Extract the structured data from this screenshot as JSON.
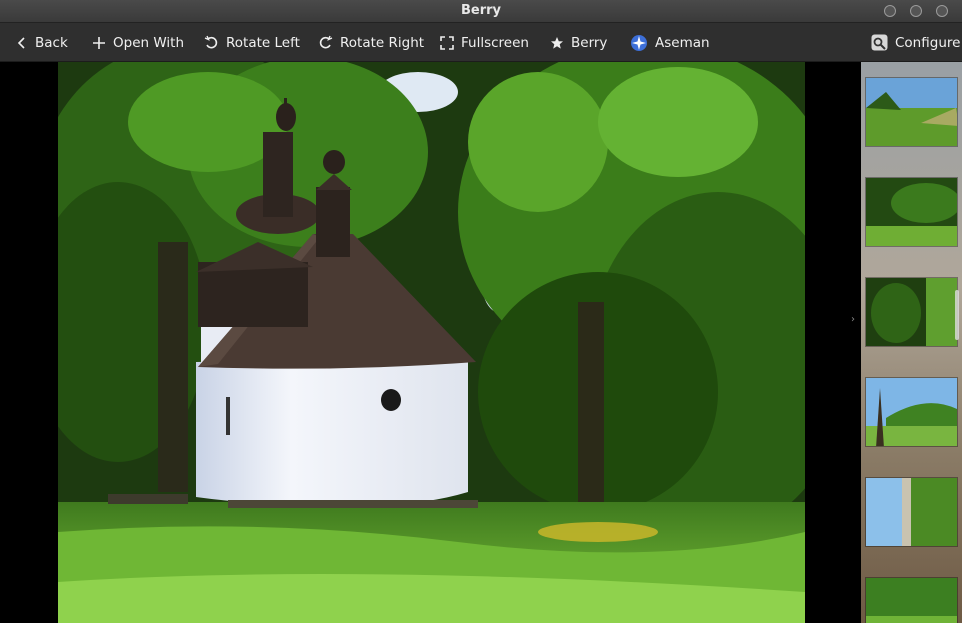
{
  "window": {
    "title": "Berry"
  },
  "toolbar": {
    "back": "Back",
    "open_with": "Open With",
    "rotate_left": "Rotate Left",
    "rotate_right": "Rotate Right",
    "fullscreen": "Fullscreen",
    "berry": "Berry",
    "aseman": "Aseman",
    "configure": "Configure"
  },
  "thumbnails": [
    {
      "icon": "meadow-sky-thumbnail"
    },
    {
      "icon": "forest-clearing-thumbnail"
    },
    {
      "icon": "rotated-forest-thumbnail"
    },
    {
      "icon": "hill-tree-thumbnail"
    },
    {
      "icon": "rotated-tree-sky-thumbnail"
    },
    {
      "icon": "forest-edge-thumbnail"
    }
  ]
}
